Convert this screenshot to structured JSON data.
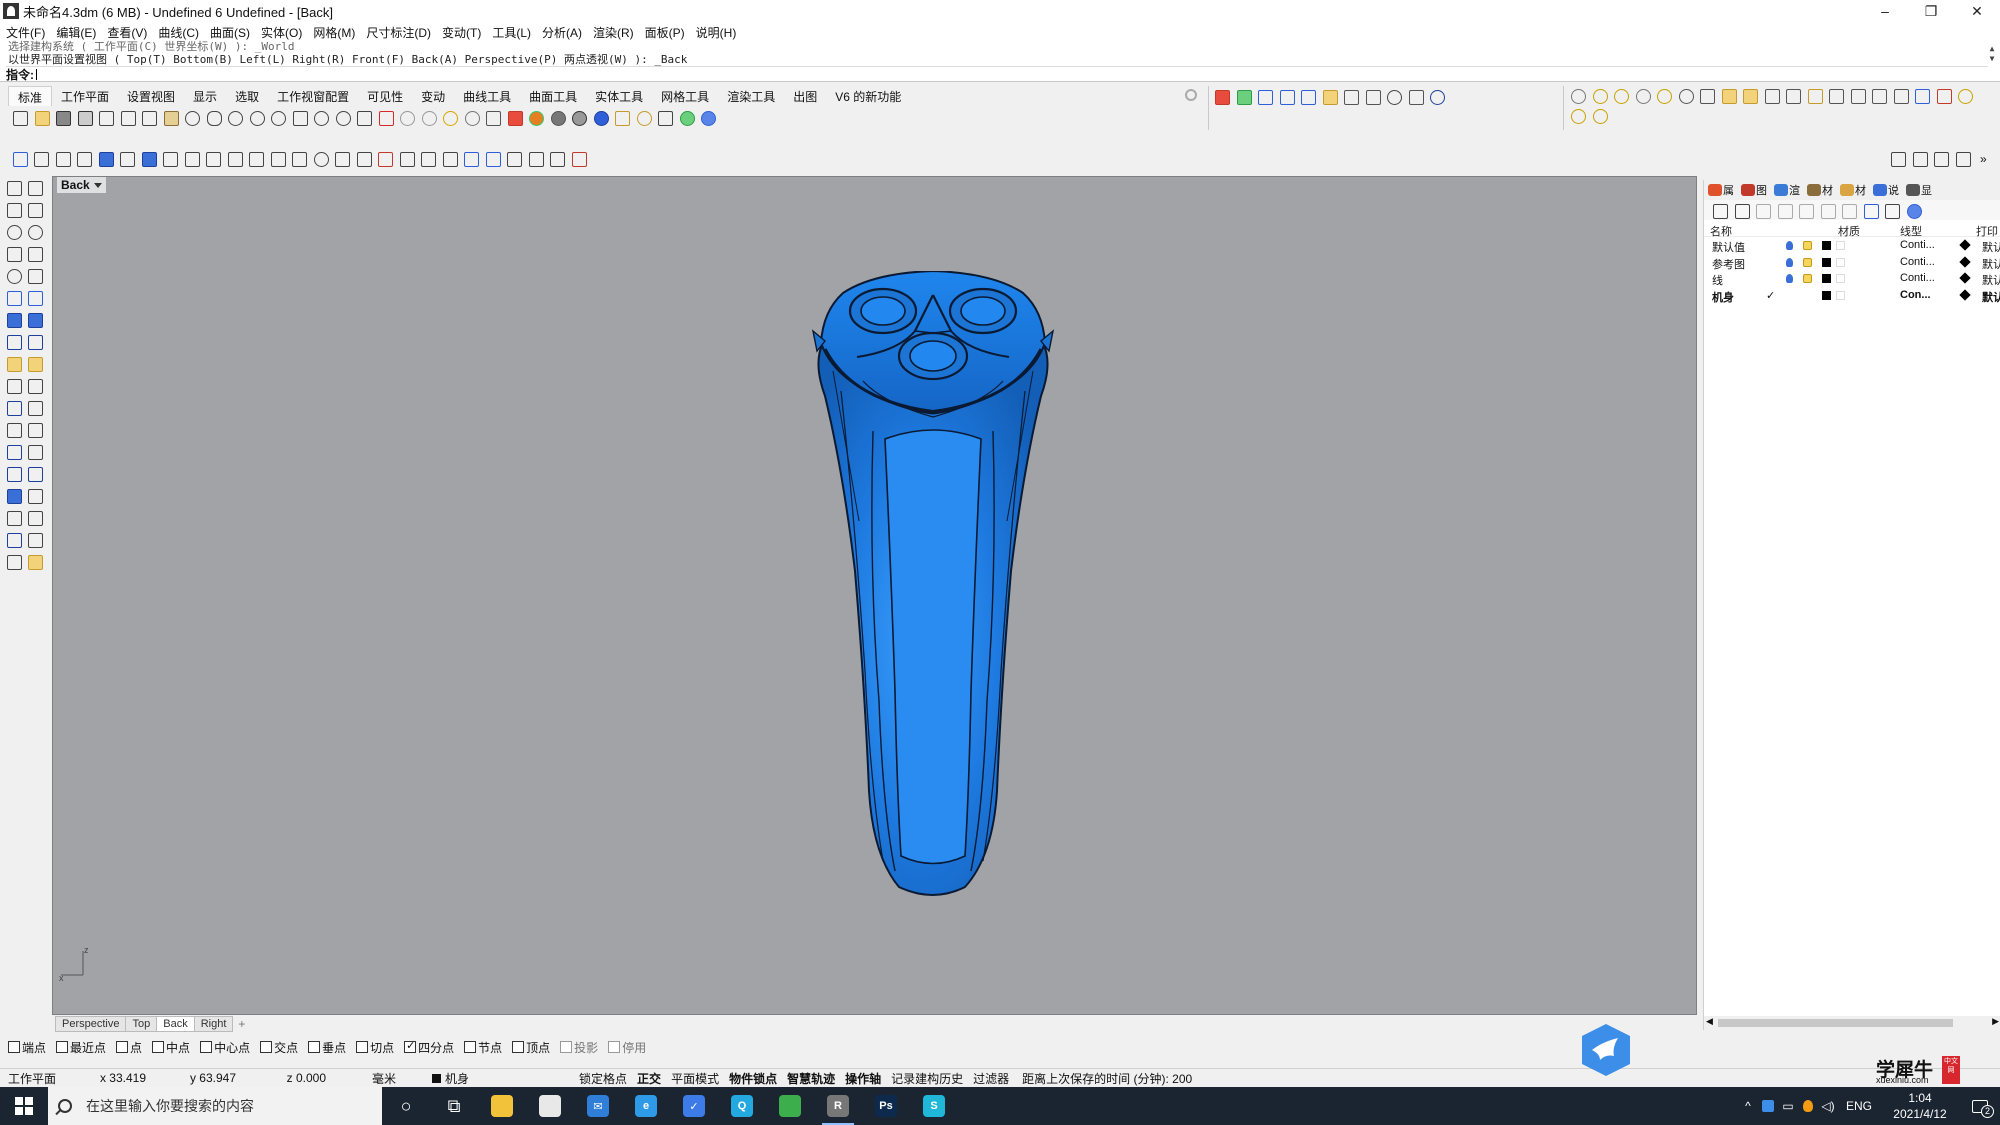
{
  "window": {
    "title": "未命名4.3dm (6 MB) - Undefined 6 Undefined - [Back]",
    "controls": [
      "–",
      "❐",
      "✕"
    ]
  },
  "menu": [
    "文件(F)",
    "编辑(E)",
    "查看(V)",
    "曲线(C)",
    "曲面(S)",
    "实体(O)",
    "网格(M)",
    "尺寸标注(D)",
    "变动(T)",
    "工具(L)",
    "分析(A)",
    "渲染(R)",
    "面板(P)",
    "说明(H)"
  ],
  "command": {
    "history1": "选择建构系统 ( 工作平面(C)  世界坐标(W) ): _World",
    "history2": "以世界平面设置视图 ( Top(T)  Bottom(B)  Left(L)  Right(R)  Front(F)  Back(A)  Perspective(P)  两点透视(W) ): _Back",
    "prompt": "指令:",
    "value": ""
  },
  "toolbar_tabs": [
    "标准",
    "工作平面",
    "设置视图",
    "显示",
    "选取",
    "工作视窗配置",
    "可见性",
    "变动",
    "曲线工具",
    "曲面工具",
    "实体工具",
    "网格工具",
    "渲染工具",
    "出图",
    "V6 的新功能"
  ],
  "active_toolbar_tab": "标准",
  "viewport": {
    "name": "Back",
    "background": "#a1a3a7",
    "model_color": "#1c74d4",
    "axis_labels": [
      "z",
      "x"
    ]
  },
  "viewport_tabs": [
    "Perspective",
    "Top",
    "Back",
    "Right"
  ],
  "active_viewport_tab": "Back",
  "add_tab_symbol": "+",
  "osnaps": [
    {
      "label": "端点",
      "checked": false,
      "enabled": true
    },
    {
      "label": "最近点",
      "checked": false,
      "enabled": true
    },
    {
      "label": "点",
      "checked": false,
      "enabled": true
    },
    {
      "label": "中点",
      "checked": false,
      "enabled": true
    },
    {
      "label": "中心点",
      "checked": false,
      "enabled": true
    },
    {
      "label": "交点",
      "checked": false,
      "enabled": true
    },
    {
      "label": "垂点",
      "checked": false,
      "enabled": true
    },
    {
      "label": "切点",
      "checked": false,
      "enabled": true
    },
    {
      "label": "四分点",
      "checked": true,
      "enabled": true
    },
    {
      "label": "节点",
      "checked": false,
      "enabled": true
    },
    {
      "label": "顶点",
      "checked": false,
      "enabled": true
    },
    {
      "label": "投影",
      "checked": false,
      "enabled": false
    },
    {
      "label": "停用",
      "checked": false,
      "enabled": false
    }
  ],
  "status": {
    "plane": "工作平面",
    "x": "x 33.419",
    "y": "y 63.947",
    "z": "z 0.000",
    "units": "毫米",
    "layer": "机身",
    "buttons": [
      {
        "label": "锁定格点",
        "bold": false
      },
      {
        "label": "正交",
        "bold": true
      },
      {
        "label": "平面模式",
        "bold": false
      },
      {
        "label": "物件锁点",
        "bold": true
      },
      {
        "label": "智慧轨迹",
        "bold": true
      },
      {
        "label": "操作轴",
        "bold": true
      },
      {
        "label": "记录建构历史",
        "bold": false
      },
      {
        "label": "过滤器",
        "bold": false
      }
    ],
    "autosave": "距离上次保存的时间 (分钟): 200"
  },
  "panel": {
    "tabs": [
      {
        "label": "属",
        "color": "#e0502a"
      },
      {
        "label": "图",
        "color": "#c0392b"
      },
      {
        "label": "渲",
        "color": "#3b7bd8"
      },
      {
        "label": "材",
        "color": "#8a6d3b"
      },
      {
        "label": "材",
        "color": "#d9a441"
      },
      {
        "label": "说",
        "color": "#3b6fd8"
      },
      {
        "label": "显",
        "color": "#555555"
      }
    ],
    "headers": {
      "name": "名称",
      "material": "材质",
      "linetype": "线型",
      "print": "打印"
    },
    "layers": [
      {
        "name": "默认值",
        "linetype": "Conti...",
        "print": "默认",
        "current": false
      },
      {
        "name": "参考图",
        "linetype": "Conti...",
        "print": "默认",
        "current": false
      },
      {
        "name": "线",
        "linetype": "Conti...",
        "print": "默认",
        "current": false
      },
      {
        "name": "机身",
        "linetype": "Con...",
        "print": "默认",
        "current": true,
        "check": "✓"
      }
    ]
  },
  "watermark": {
    "main": "学犀牛",
    "sub": "xuexiniu.com",
    "seal": "中文网"
  },
  "taskbar": {
    "search_placeholder": "在这里输入你要搜索的内容",
    "apps": [
      {
        "name": "cortana",
        "glyph": "○",
        "color": "transparent"
      },
      {
        "name": "task-view",
        "glyph": "⧉",
        "color": "transparent"
      },
      {
        "name": "file-explorer",
        "glyph": "",
        "color": "#f3c23b"
      },
      {
        "name": "store",
        "glyph": "",
        "color": "#e8e8e8"
      },
      {
        "name": "mail",
        "glyph": "✉",
        "color": "#2f7fd8"
      },
      {
        "name": "browser",
        "glyph": "e",
        "color": "#2f9be8"
      },
      {
        "name": "feishu",
        "glyph": "✓",
        "color": "#3c7be8"
      },
      {
        "name": "qq",
        "glyph": "Q",
        "color": "#23a9e0"
      },
      {
        "name": "green-app",
        "glyph": "",
        "color": "#3cae4c"
      },
      {
        "name": "rhino",
        "glyph": "R",
        "color": "#777777",
        "active": true
      },
      {
        "name": "photoshop",
        "glyph": "Ps",
        "color": "#0d2a4e"
      },
      {
        "name": "chat-app",
        "glyph": "S",
        "color": "#1fb6d8"
      }
    ],
    "tray": {
      "lang": "ENG",
      "time": "1:04",
      "date": "2021/4/12",
      "notifications": "2",
      "show_hidden": "^"
    }
  }
}
